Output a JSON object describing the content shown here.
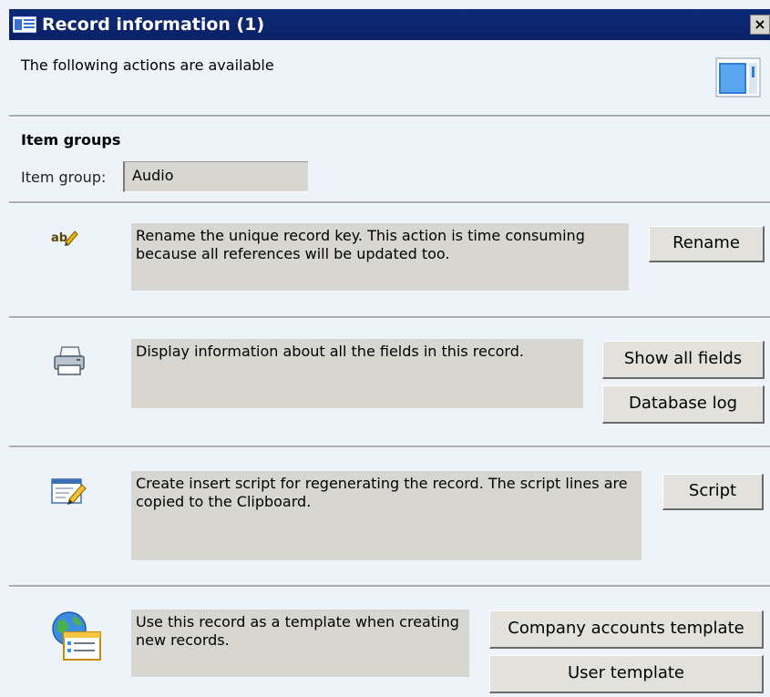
{
  "window": {
    "title": "Record information (1)",
    "close_label": "×"
  },
  "header": {
    "subtitle": "The following actions are available"
  },
  "item_groups": {
    "heading": "Item groups",
    "field_label": "Item group:",
    "field_value": "Audio"
  },
  "actions": {
    "rename": {
      "description": "Rename the unique record key. This action is time consuming because all references will be updated too.",
      "button": "Rename"
    },
    "fields": {
      "description": "Display information about all the fields in this record.",
      "show_all_fields": "Show all fields",
      "database_log": "Database log"
    },
    "script": {
      "description": "Create insert script for regenerating the record. The script lines are copied to the Clipboard.",
      "button": "Script"
    },
    "template": {
      "description": "Use this record as a template when creating new records.",
      "company_accounts_template": "Company accounts template",
      "user_template": "User template"
    }
  },
  "colors": {
    "titlebar": "#0d2a78",
    "window_background": "#eef3fa",
    "field_background": "#d8d6d0"
  }
}
